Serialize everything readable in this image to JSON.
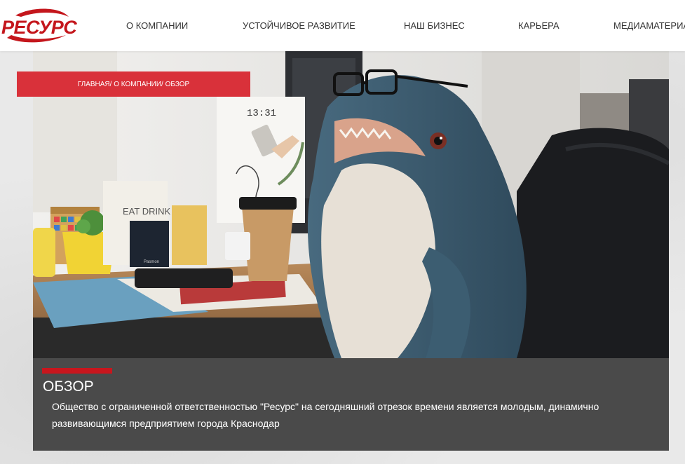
{
  "brand": {
    "logo_text": "РЕСУРС",
    "accent": "#c8161d"
  },
  "nav": {
    "items": [
      {
        "label": "О КОМПАНИИ"
      },
      {
        "label": "УСТОЙЧИВОЕ РАЗВИТИЕ"
      },
      {
        "label": "НАШ БИЗНЕС"
      },
      {
        "label": "КАРЬЕРА"
      },
      {
        "label": "МЕДИАМАТЕРИАЛЫ"
      }
    ]
  },
  "breadcrumb": {
    "text": "ГЛАВНАЯ/ О КОМПАНИИ/ ОБЗОР"
  },
  "hero": {
    "clock_text": "13:31",
    "box_text": "EAT DRINK",
    "powerbank_text": "Pasmon"
  },
  "overview": {
    "title": "ОБЗОР",
    "text": "Общество с ограниченной ответственностью \"Ресурс\" на сегодняшний отрезок времени является молодым, динамично развивающимся предприятием города Краснодар"
  }
}
